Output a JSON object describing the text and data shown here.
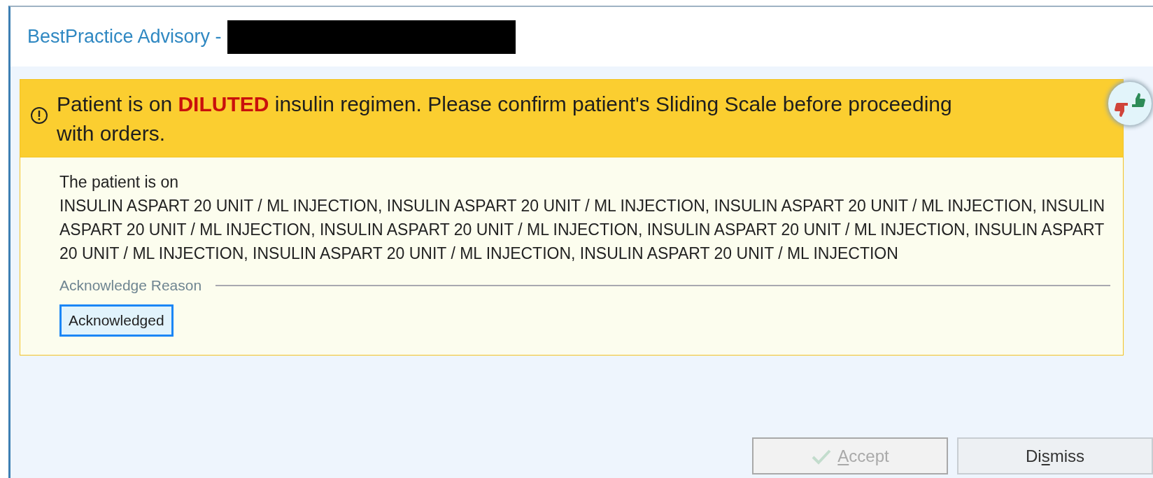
{
  "window": {
    "title": "BestPractice Advisory -"
  },
  "alert": {
    "message": "Patient is on **DILUTED** insulin regimen. Please confirm patient's Sliding Scale before proceeding with orders.",
    "intro": "The patient is on",
    "details": "INSULIN ASPART 20 UNIT / ML INJECTION, INSULIN ASPART 20 UNIT / ML INJECTION, INSULIN ASPART 20 UNIT / ML INJECTION, INSULIN ASPART 20 UNIT / ML INJECTION, INSULIN ASPART 20 UNIT / ML INJECTION, INSULIN ASPART 20 UNIT / ML INJECTION, INSULIN ASPART 20 UNIT / ML INJECTION, INSULIN ASPART 20 UNIT / ML INJECTION, INSULIN ASPART 20 UNIT / ML INJECTION",
    "reason_label": "Acknowledge Reason",
    "reasons": [
      {
        "label": "Acknowledged",
        "selected": true
      }
    ]
  },
  "buttons": [
    {
      "kind": "accept",
      "access_key": "A",
      "after": "ccept",
      "disabled": true
    },
    {
      "kind": "plain",
      "before": "Di",
      "access_key": "s",
      "after": "miss",
      "disabled": false
    }
  ]
}
